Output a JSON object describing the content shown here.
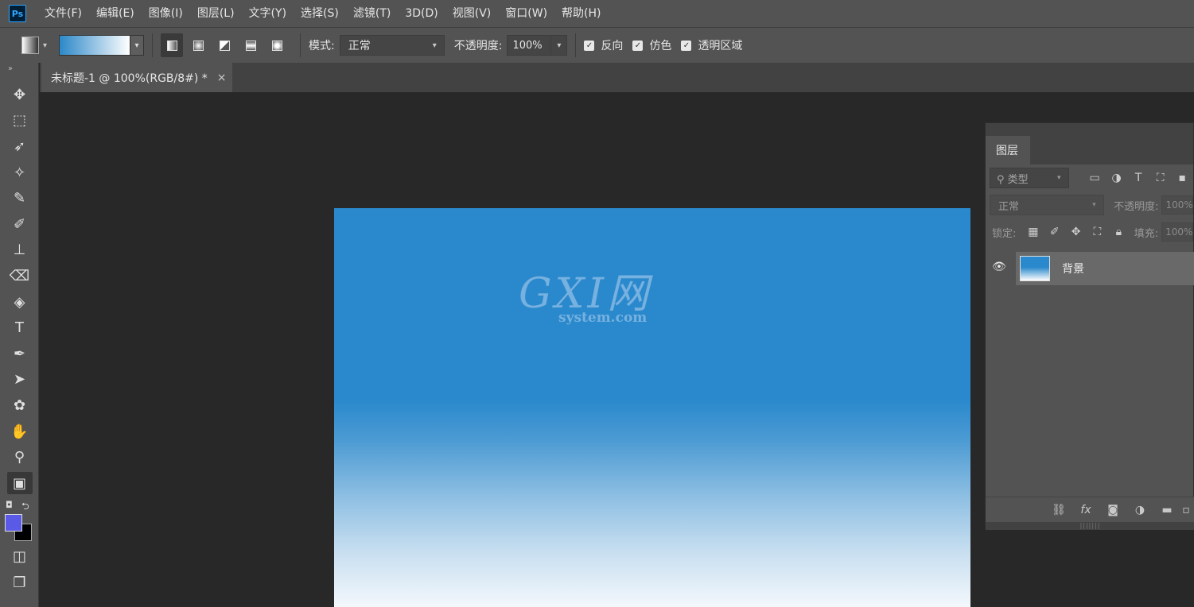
{
  "app": {
    "logo": "Ps"
  },
  "menu": [
    "文件(F)",
    "编辑(E)",
    "图像(I)",
    "图层(L)",
    "文字(Y)",
    "选择(S)",
    "滤镜(T)",
    "3D(D)",
    "视图(V)",
    "窗口(W)",
    "帮助(H)"
  ],
  "options": {
    "mode_label": "模式:",
    "mode_value": "正常",
    "opacity_label": "不透明度:",
    "opacity_value": "100%",
    "reverse_label": "反向",
    "dither_label": "仿色",
    "transparency_label": "透明区域",
    "gradient_start_color": "#2b88c8",
    "gradient_end_color": "#ffffff"
  },
  "document": {
    "tab_title": "未标题-1 @ 100%(RGB/8#) *",
    "close_glyph": "×"
  },
  "canvas": {
    "watermark_big": "GXI网",
    "watermark_small": "system.com",
    "top_color": "#2a89cc",
    "bottom_color": "#f3f8fc"
  },
  "tools": {
    "foreground_color": "#5a5ae6",
    "background_color": "#000000",
    "items": [
      {
        "name": "move-tool",
        "glyph": "✥"
      },
      {
        "name": "marquee-tool",
        "glyph": "⬚"
      },
      {
        "name": "lasso-tool",
        "glyph": "➶"
      },
      {
        "name": "magic-wand-tool",
        "glyph": "✧"
      },
      {
        "name": "eyedropper-tool",
        "glyph": "✎"
      },
      {
        "name": "brush-tool",
        "glyph": "✐"
      },
      {
        "name": "stamp-tool",
        "glyph": "⊥"
      },
      {
        "name": "eraser-tool",
        "glyph": "⌫"
      },
      {
        "name": "paint-bucket-tool",
        "glyph": "◈"
      },
      {
        "name": "type-tool",
        "glyph": "T"
      },
      {
        "name": "pen-tool",
        "glyph": "✒"
      },
      {
        "name": "path-selection-tool",
        "glyph": "➤"
      },
      {
        "name": "custom-shape-tool",
        "glyph": "✿"
      },
      {
        "name": "hand-tool",
        "glyph": "✋"
      },
      {
        "name": "zoom-tool",
        "glyph": "⚲"
      },
      {
        "name": "gradient-tool",
        "glyph": "▣"
      }
    ]
  },
  "layers_panel": {
    "tab_label": "图层",
    "filter_placeholder": "类型",
    "blend_mode": "正常",
    "opacity_label": "不透明度:",
    "opacity_value": "100%",
    "lock_label": "锁定:",
    "fill_label": "填充:",
    "fill_value": "100%",
    "layers": [
      {
        "name": "背景"
      }
    ]
  }
}
